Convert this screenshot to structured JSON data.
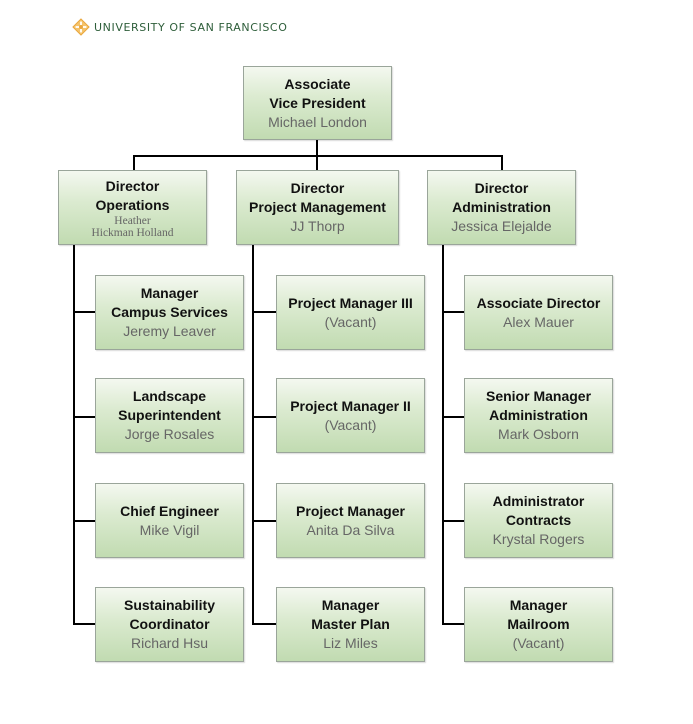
{
  "header": {
    "logo_text": "UNIVERSITY OF SAN FRANCISCO",
    "logo_icon": "cross-emblem-icon",
    "brand_color": "#2e5e3a",
    "logo_icon_color": "#f0b64a"
  },
  "chart_data": {
    "type": "org-chart",
    "root": {
      "title": "Associate\nVice President",
      "name": "Michael London"
    },
    "directors": [
      {
        "title": "Director\nOperations",
        "name": "Heather\nHickman Holland",
        "reports": [
          {
            "title": "Manager\nCampus Services",
            "name": "Jeremy Leaver"
          },
          {
            "title": "Landscape\nSuperintendent",
            "name": "Jorge Rosales"
          },
          {
            "title": "Chief Engineer",
            "name": "Mike Vigil"
          },
          {
            "title": "Sustainability\nCoordinator",
            "name": "Richard Hsu"
          }
        ]
      },
      {
        "title": "Director\nProject Management",
        "name": "JJ Thorp",
        "reports": [
          {
            "title": "Project Manager III",
            "name": "(Vacant)"
          },
          {
            "title": "Project Manager II",
            "name": "(Vacant)"
          },
          {
            "title": "Project Manager",
            "name": "Anita Da Silva"
          },
          {
            "title": "Manager\nMaster Plan",
            "name": "Liz Miles"
          }
        ]
      },
      {
        "title": "Director\nAdministration",
        "name": "Jessica Elejalde",
        "reports": [
          {
            "title": "Associate Director",
            "name": "Alex Mauer"
          },
          {
            "title": "Senior Manager\nAdministration",
            "name": "Mark Osborn"
          },
          {
            "title": "Administrator\nContracts",
            "name": "Krystal Rogers"
          },
          {
            "title": "Manager\nMailroom",
            "name": "(Vacant)"
          }
        ]
      }
    ]
  }
}
